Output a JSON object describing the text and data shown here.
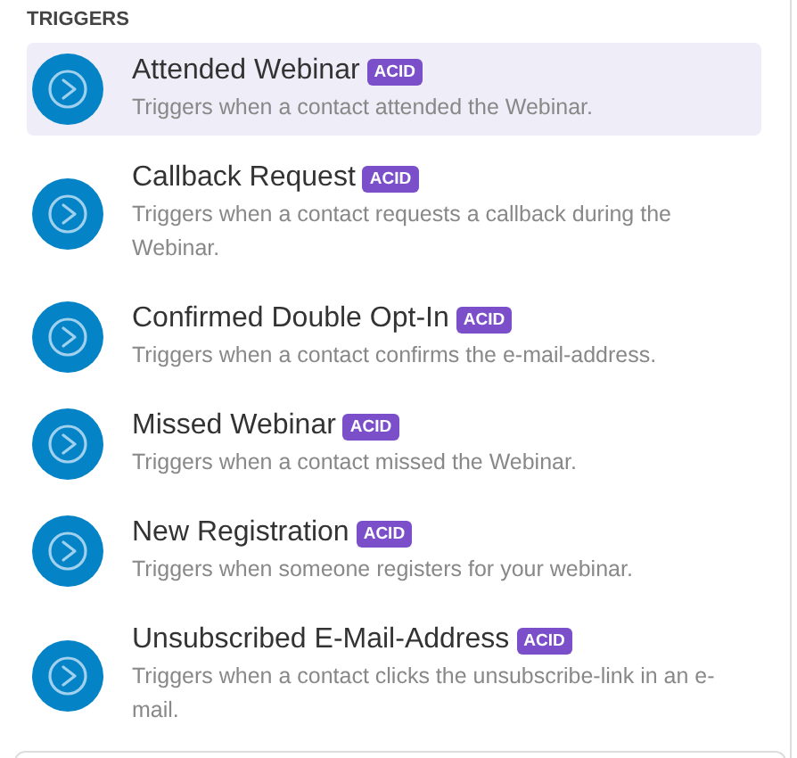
{
  "section": {
    "title": "TRIGGERS"
  },
  "triggers": [
    {
      "title": "Attended Webinar",
      "badge": "ACID",
      "description": "Triggers when a contact attended the Webinar.",
      "selected": true
    },
    {
      "title": "Callback Request",
      "badge": "ACID",
      "description": "Triggers when a contact requests a callback during the Webinar.",
      "selected": false
    },
    {
      "title": "Confirmed Double Opt-In",
      "badge": "ACID",
      "description": "Triggers when a contact confirms the e-mail-address.",
      "selected": false
    },
    {
      "title": "Missed Webinar",
      "badge": "ACID",
      "description": "Triggers when a contact missed the Webinar.",
      "selected": false
    },
    {
      "title": "New Registration",
      "badge": "ACID",
      "description": "Triggers when someone registers for your webinar.",
      "selected": false
    },
    {
      "title": "Unsubscribed E-Mail-Address",
      "badge": "ACID",
      "description": "Triggers when a contact clicks the unsubscribe-link in an e-mail.",
      "selected": false
    }
  ]
}
